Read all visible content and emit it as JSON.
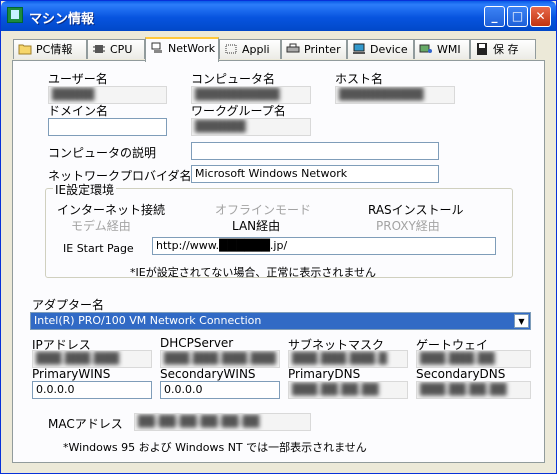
{
  "window": {
    "title": "マシン情報",
    "controls": {
      "minimize": "_",
      "maximize": "□",
      "close": "✕"
    }
  },
  "tabs": [
    {
      "label": "PC情報",
      "icon": "folder-icon",
      "active": false
    },
    {
      "label": "CPU",
      "icon": "chip-icon",
      "active": false
    },
    {
      "label": "NetWork",
      "icon": "network-icon",
      "active": true
    },
    {
      "label": "Appli",
      "icon": "appli-icon",
      "active": false
    },
    {
      "label": "Printer",
      "icon": "printer-icon",
      "active": false
    },
    {
      "label": "Device",
      "icon": "device-icon",
      "active": false
    },
    {
      "label": "WMI",
      "icon": "wmi-icon",
      "active": false
    },
    {
      "label": "保 存",
      "icon": "save-icon",
      "active": false
    }
  ],
  "network": {
    "username_label": "ユーザー名",
    "username_value": "█████",
    "computername_label": "コンピュータ名",
    "computername_value": "██████████",
    "hostname_label": "ホスト名",
    "hostname_value": "██████████",
    "domain_label": "ドメイン名",
    "domain_value": "",
    "workgroup_label": "ワークグループ名",
    "workgroup_value": "██████",
    "description_label": "コンピュータの説明",
    "description_value": "",
    "provider_label": "ネットワークプロバイダ名",
    "provider_value": "Microsoft Windows Network"
  },
  "ie": {
    "group_title": "IE設定環境",
    "internet_connection": "インターネット接続",
    "offline_mode": "オフラインモード",
    "ras_install": "RASインストール",
    "via_modem": "モデム経由",
    "via_lan": "LAN経由",
    "via_proxy": "PROXY経由",
    "start_page_label": "IE Start Page",
    "start_page_value": "http://www.██████.jp/",
    "note": "*IEが設定されてない場合、正常に表示されません"
  },
  "adapter": {
    "label": "アダプター名",
    "selected": "Intel(R) PRO/100 VM Network Connection",
    "ip_label": "IPアドレス",
    "ip_value": "███.███.███",
    "dhcp_label": "DHCPServer",
    "dhcp_value": "███.███.███.███",
    "subnet_label": "サブネットマスク",
    "subnet_value": "███.███.███.█",
    "gateway_label": "ゲートウェイ",
    "gateway_value": "███.███.██",
    "primary_wins_label": "PrimaryWINS",
    "primary_wins_value": "0.0.0.0",
    "secondary_wins_label": "SecondaryWINS",
    "secondary_wins_value": "0.0.0.0",
    "primary_dns_label": "PrimaryDNS",
    "primary_dns_value": "███.██.██.██",
    "secondary_dns_label": "SecondaryDNS",
    "secondary_dns_value": "███.██.██.██",
    "mac_label": "MACアドレス",
    "mac_value": "██-██-██-██-██-██",
    "footnote": "*Windows 95 および Windows NT では一部表示されません"
  },
  "colors": {
    "titlebar": "#0A5BE6",
    "selection": "#316AC5",
    "tab_highlight": "#FFC83C",
    "face": "#ECE9D8"
  }
}
